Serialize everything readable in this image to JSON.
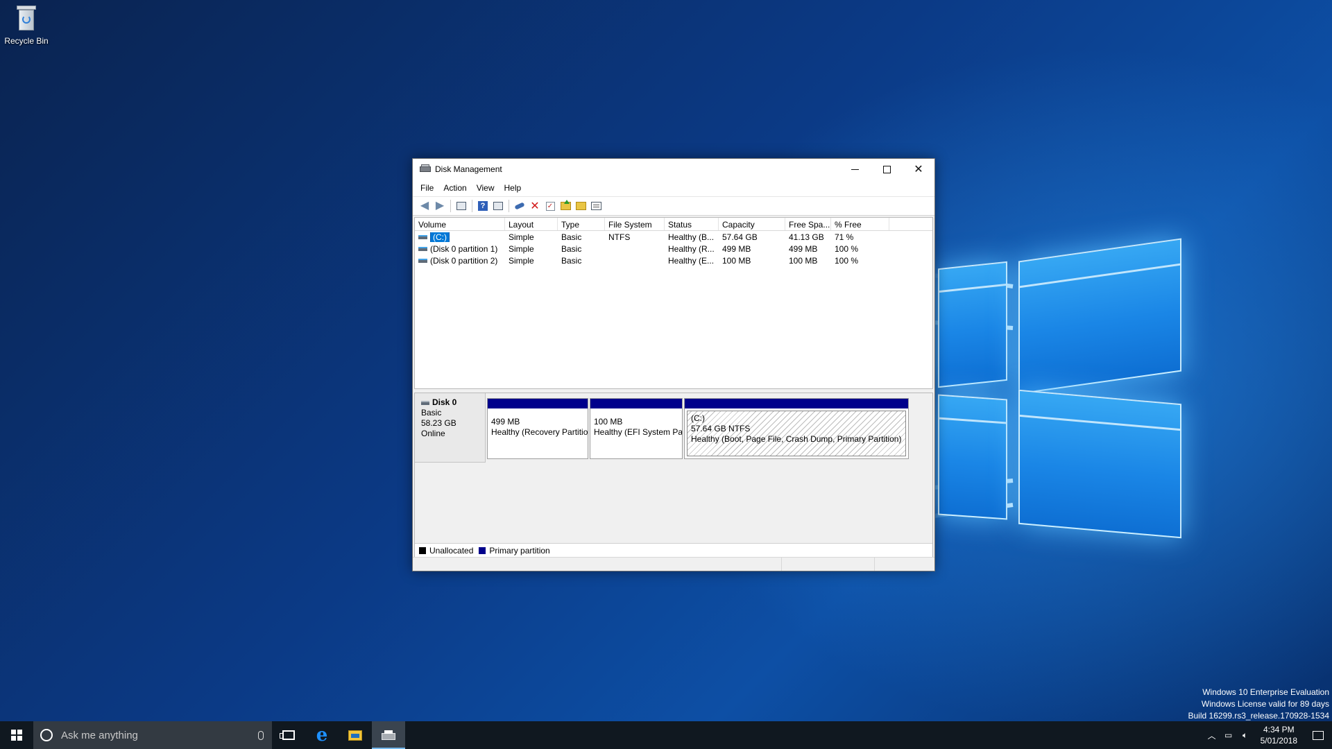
{
  "desktop": {
    "recycle_bin_label": "Recycle Bin",
    "watermark": {
      "line1": "Windows 10 Enterprise Evaluation",
      "line2": "Windows License valid for 89 days",
      "line3": "Build 16299.rs3_release.170928-1534"
    }
  },
  "window": {
    "title": "Disk Management",
    "menu": [
      "File",
      "Action",
      "View",
      "Help"
    ],
    "toolbar_icons": [
      "back-arrow-icon",
      "forward-arrow-icon",
      "console-tree-icon",
      "help-icon",
      "properties-view-icon",
      "connect-icon",
      "delete-icon",
      "check-icon",
      "import-icon",
      "rescan-icon",
      "properties-icon"
    ],
    "columns": [
      "Volume",
      "Layout",
      "Type",
      "File System",
      "Status",
      "Capacity",
      "Free Spa...",
      "% Free"
    ],
    "rows": [
      {
        "volume": "(C:)",
        "layout": "Simple",
        "type": "Basic",
        "fs": "NTFS",
        "status": "Healthy (B...",
        "capacity": "57.64 GB",
        "free": "41.13 GB",
        "pct": "71 %",
        "selected": true
      },
      {
        "volume": "(Disk 0 partition 1)",
        "layout": "Simple",
        "type": "Basic",
        "fs": "",
        "status": "Healthy (R...",
        "capacity": "499 MB",
        "free": "499 MB",
        "pct": "100 %"
      },
      {
        "volume": "(Disk 0 partition 2)",
        "layout": "Simple",
        "type": "Basic",
        "fs": "",
        "status": "Healthy (E...",
        "capacity": "100 MB",
        "free": "100 MB",
        "pct": "100 %"
      }
    ],
    "disk": {
      "name": "Disk 0",
      "type": "Basic",
      "size": "58.23 GB",
      "state": "Online",
      "partitions": [
        {
          "line1": "499 MB",
          "line2": "Healthy (Recovery Partition)"
        },
        {
          "line1": "100 MB",
          "line2": "Healthy (EFI System Pa"
        },
        {
          "title": "(C:)",
          "line1": "57.64 GB NTFS",
          "line2": "Healthy (Boot, Page File, Crash Dump, Primary Partition)"
        }
      ]
    },
    "legend": {
      "unallocated": "Unallocated",
      "primary": "Primary partition",
      "unallocated_color": "#000000",
      "primary_color": "#00008b"
    }
  },
  "taskbar": {
    "search_placeholder": "Ask me anything",
    "time": "4:34 PM",
    "date": "5/01/2018"
  }
}
